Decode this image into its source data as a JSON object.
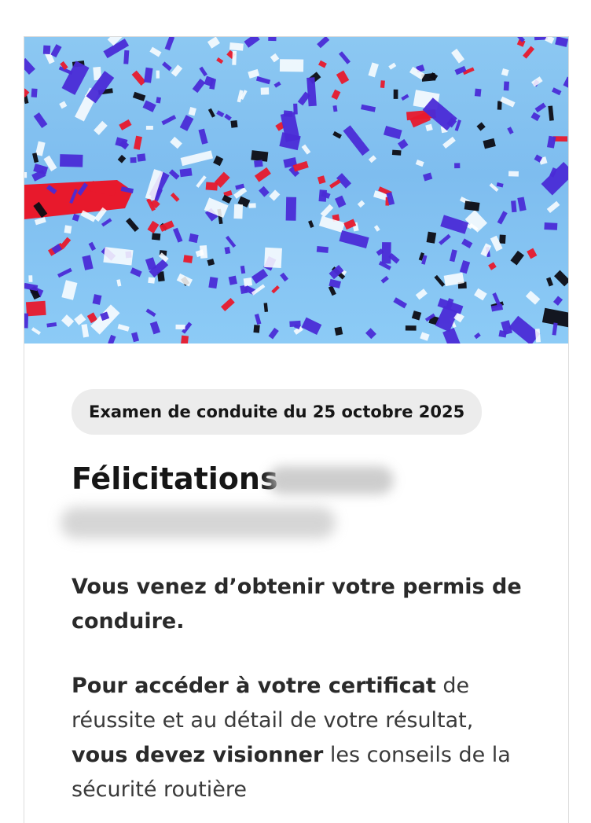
{
  "exam": {
    "badge": "Examen de conduite du 25 octobre 2025"
  },
  "heading": {
    "title": "Félicitations"
  },
  "message": {
    "line1": "Vous venez d’obtenir votre permis de conduire.",
    "p2_bold1": "Pour accéder à votre certificat",
    "p2_text1": " de réussite et au détail de votre résultat, ",
    "p2_bold2": "vous devez visionner",
    "p2_text2": " les conseils de la sécurité routière"
  },
  "colors": {
    "sky": "#7ebdef",
    "confetti_red": "#e8192c",
    "confetti_blue": "#4a2bd6",
    "confetti_white": "#ffffff",
    "confetti_black": "#0d0d14"
  }
}
